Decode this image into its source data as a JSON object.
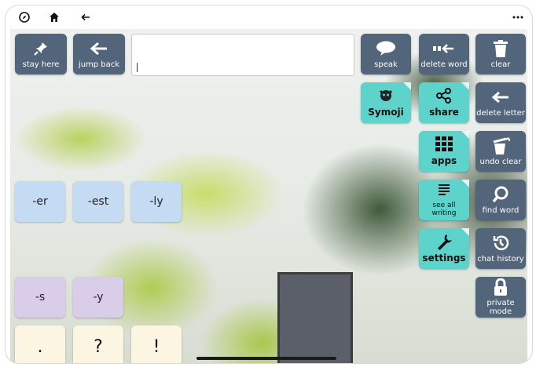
{
  "topbar": {
    "icons": [
      "compass-icon",
      "home-icon",
      "back-arrow-icon",
      "more-icon"
    ]
  },
  "message_box": {
    "value": ""
  },
  "left_buttons": {
    "stay_here": "stay here",
    "jump_back": "jump back"
  },
  "suffixes": {
    "er": "-er",
    "est": "-est",
    "ly": "-ly",
    "s": "-s",
    "y": "-y"
  },
  "punctuation": {
    "period": ".",
    "question": "?",
    "exclamation": "!"
  },
  "actions": {
    "speak": "speak",
    "delete_word": "delete word",
    "clear": "clear",
    "delete_letter": "delete letter",
    "undo_clear": "undo clear",
    "find_word": "find word",
    "chat_history": "chat history",
    "private_mode": "private mode"
  },
  "folders": {
    "symoji": "Symoji",
    "share": "share",
    "apps": "apps",
    "see_all_writing": "see all writing",
    "settings": "settings"
  },
  "colors": {
    "slate": "#52657a",
    "teal": "#5ed3cb",
    "blue": "#c4dbf3",
    "lavender": "#d9cdea",
    "cream": "#fbf5e2"
  }
}
